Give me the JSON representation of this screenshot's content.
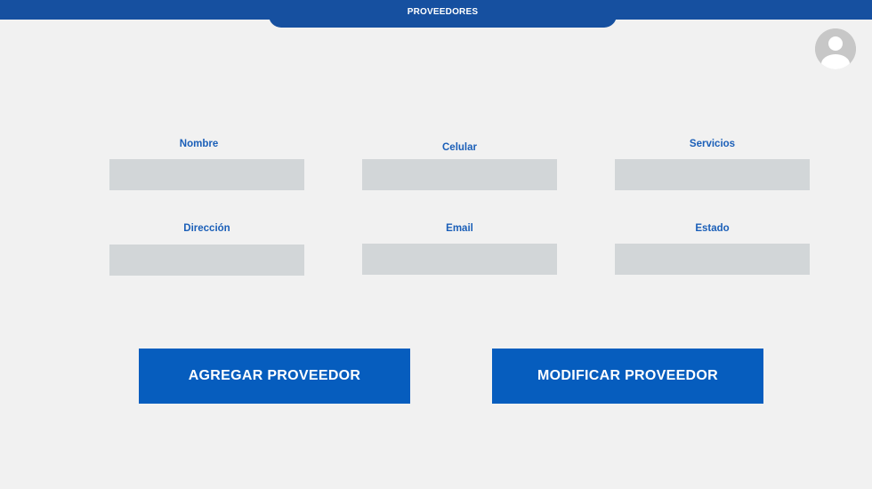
{
  "header": {
    "title": "PROVEEDORES"
  },
  "user": {
    "avatar_icon": "user-avatar-icon"
  },
  "form": {
    "nombre": {
      "label": "Nombre",
      "value": ""
    },
    "celular": {
      "label": "Celular",
      "value": ""
    },
    "servicios": {
      "label": "Servicios",
      "value": ""
    },
    "direccion": {
      "label": "Dirección",
      "value": ""
    },
    "email": {
      "label": "Email",
      "value": ""
    },
    "estado": {
      "label": "Estado",
      "value": ""
    }
  },
  "actions": {
    "add_label": "AGREGAR PROVEEDOR",
    "modify_label": "MODIFICAR PROVEEDOR"
  },
  "colors": {
    "header_bg": "#1650a0",
    "label_color": "#1b5fb8",
    "input_bg": "#d2d6d8",
    "button_bg": "#065dbe",
    "page_bg": "#f1f1f1"
  }
}
